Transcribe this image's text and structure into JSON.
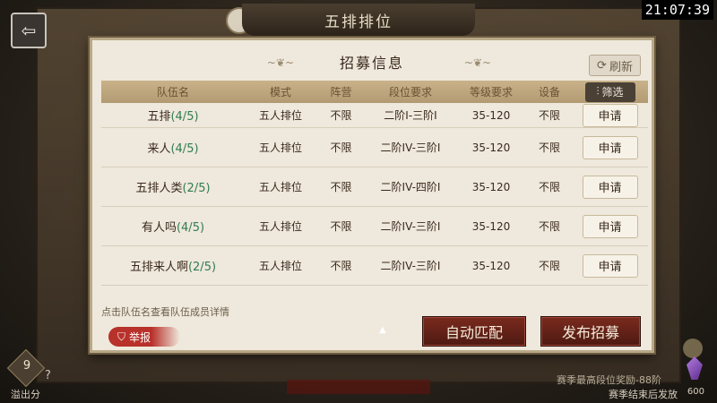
{
  "header": {
    "page_title": "五排排位",
    "clock": "21:07:39"
  },
  "panel": {
    "title": "招募信息",
    "refresh_label": "刷新",
    "filter_label": "筛选",
    "columns": [
      "队伍名",
      "模式",
      "阵营",
      "段位要求",
      "等级要求",
      "设备"
    ],
    "rows": [
      {
        "name": "五排",
        "count": "(4/5)",
        "mode": "五人排位",
        "camp": "不限",
        "rank": "二阶I-三阶I",
        "level": "35-120",
        "device": "不限",
        "action": "申请"
      },
      {
        "name": "来人",
        "count": "(4/5)",
        "mode": "五人排位",
        "camp": "不限",
        "rank": "二阶IV-三阶I",
        "level": "35-120",
        "device": "不限",
        "action": "申请"
      },
      {
        "name": "五排人类",
        "count": "(2/5)",
        "mode": "五人排位",
        "camp": "不限",
        "rank": "二阶IV-四阶I",
        "level": "35-120",
        "device": "不限",
        "action": "申请"
      },
      {
        "name": "有人吗",
        "count": "(4/5)",
        "mode": "五人排位",
        "camp": "不限",
        "rank": "二阶IV-三阶I",
        "level": "35-120",
        "device": "不限",
        "action": "申请"
      },
      {
        "name": "五排来人啊",
        "count": "(2/5)",
        "mode": "五人排位",
        "camp": "不限",
        "rank": "二阶IV-三阶I",
        "level": "35-120",
        "device": "不限",
        "action": "申请"
      }
    ],
    "hint": "点击队伍名查看队伍成员详情",
    "report_label": "举报",
    "auto_match_label": "自动匹配",
    "publish_label": "发布招募"
  },
  "footer": {
    "score_value": "9",
    "score_help": "?",
    "score_label": "溢出分",
    "season_reward": "赛季最高段位奖励-88阶",
    "season_end": "赛季结束后发放",
    "crystal_count": "600"
  },
  "colors": {
    "accent_red": "#7a2a1e",
    "count_green": "#2f7d4f",
    "header_tan": "#c9b28a"
  }
}
